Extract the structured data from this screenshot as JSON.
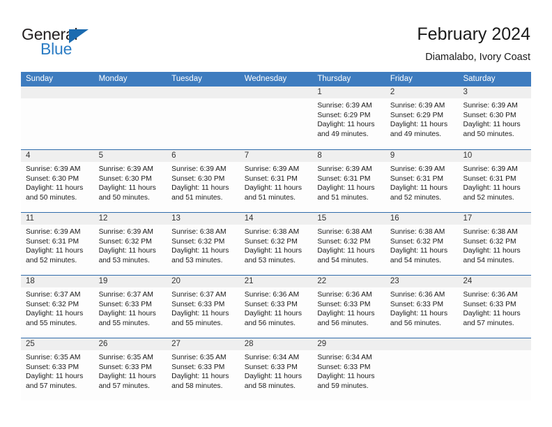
{
  "brand": {
    "name_top": "General",
    "name_bottom": "Blue",
    "accent_color": "#2b7cc4",
    "triangle_color": "#1b6bb0"
  },
  "header": {
    "title": "February 2024",
    "subtitle": "Diamalabo, Ivory Coast"
  },
  "calendar": {
    "header_bg": "#3e7cbf",
    "row_divider_color": "#2f6cab",
    "daynum_band_color": "#efefef",
    "weekdays": [
      "Sunday",
      "Monday",
      "Tuesday",
      "Wednesday",
      "Thursday",
      "Friday",
      "Saturday"
    ],
    "weeks": [
      [
        {
          "day": "",
          "lines": []
        },
        {
          "day": "",
          "lines": []
        },
        {
          "day": "",
          "lines": []
        },
        {
          "day": "",
          "lines": []
        },
        {
          "day": "1",
          "lines": [
            "Sunrise: 6:39 AM",
            "Sunset: 6:29 PM",
            "Daylight: 11 hours",
            "and 49 minutes."
          ]
        },
        {
          "day": "2",
          "lines": [
            "Sunrise: 6:39 AM",
            "Sunset: 6:29 PM",
            "Daylight: 11 hours",
            "and 49 minutes."
          ]
        },
        {
          "day": "3",
          "lines": [
            "Sunrise: 6:39 AM",
            "Sunset: 6:30 PM",
            "Daylight: 11 hours",
            "and 50 minutes."
          ]
        }
      ],
      [
        {
          "day": "4",
          "lines": [
            "Sunrise: 6:39 AM",
            "Sunset: 6:30 PM",
            "Daylight: 11 hours",
            "and 50 minutes."
          ]
        },
        {
          "day": "5",
          "lines": [
            "Sunrise: 6:39 AM",
            "Sunset: 6:30 PM",
            "Daylight: 11 hours",
            "and 50 minutes."
          ]
        },
        {
          "day": "6",
          "lines": [
            "Sunrise: 6:39 AM",
            "Sunset: 6:30 PM",
            "Daylight: 11 hours",
            "and 51 minutes."
          ]
        },
        {
          "day": "7",
          "lines": [
            "Sunrise: 6:39 AM",
            "Sunset: 6:31 PM",
            "Daylight: 11 hours",
            "and 51 minutes."
          ]
        },
        {
          "day": "8",
          "lines": [
            "Sunrise: 6:39 AM",
            "Sunset: 6:31 PM",
            "Daylight: 11 hours",
            "and 51 minutes."
          ]
        },
        {
          "day": "9",
          "lines": [
            "Sunrise: 6:39 AM",
            "Sunset: 6:31 PM",
            "Daylight: 11 hours",
            "and 52 minutes."
          ]
        },
        {
          "day": "10",
          "lines": [
            "Sunrise: 6:39 AM",
            "Sunset: 6:31 PM",
            "Daylight: 11 hours",
            "and 52 minutes."
          ]
        }
      ],
      [
        {
          "day": "11",
          "lines": [
            "Sunrise: 6:39 AM",
            "Sunset: 6:31 PM",
            "Daylight: 11 hours",
            "and 52 minutes."
          ]
        },
        {
          "day": "12",
          "lines": [
            "Sunrise: 6:39 AM",
            "Sunset: 6:32 PM",
            "Daylight: 11 hours",
            "and 53 minutes."
          ]
        },
        {
          "day": "13",
          "lines": [
            "Sunrise: 6:38 AM",
            "Sunset: 6:32 PM",
            "Daylight: 11 hours",
            "and 53 minutes."
          ]
        },
        {
          "day": "14",
          "lines": [
            "Sunrise: 6:38 AM",
            "Sunset: 6:32 PM",
            "Daylight: 11 hours",
            "and 53 minutes."
          ]
        },
        {
          "day": "15",
          "lines": [
            "Sunrise: 6:38 AM",
            "Sunset: 6:32 PM",
            "Daylight: 11 hours",
            "and 54 minutes."
          ]
        },
        {
          "day": "16",
          "lines": [
            "Sunrise: 6:38 AM",
            "Sunset: 6:32 PM",
            "Daylight: 11 hours",
            "and 54 minutes."
          ]
        },
        {
          "day": "17",
          "lines": [
            "Sunrise: 6:38 AM",
            "Sunset: 6:32 PM",
            "Daylight: 11 hours",
            "and 54 minutes."
          ]
        }
      ],
      [
        {
          "day": "18",
          "lines": [
            "Sunrise: 6:37 AM",
            "Sunset: 6:32 PM",
            "Daylight: 11 hours",
            "and 55 minutes."
          ]
        },
        {
          "day": "19",
          "lines": [
            "Sunrise: 6:37 AM",
            "Sunset: 6:33 PM",
            "Daylight: 11 hours",
            "and 55 minutes."
          ]
        },
        {
          "day": "20",
          "lines": [
            "Sunrise: 6:37 AM",
            "Sunset: 6:33 PM",
            "Daylight: 11 hours",
            "and 55 minutes."
          ]
        },
        {
          "day": "21",
          "lines": [
            "Sunrise: 6:36 AM",
            "Sunset: 6:33 PM",
            "Daylight: 11 hours",
            "and 56 minutes."
          ]
        },
        {
          "day": "22",
          "lines": [
            "Sunrise: 6:36 AM",
            "Sunset: 6:33 PM",
            "Daylight: 11 hours",
            "and 56 minutes."
          ]
        },
        {
          "day": "23",
          "lines": [
            "Sunrise: 6:36 AM",
            "Sunset: 6:33 PM",
            "Daylight: 11 hours",
            "and 56 minutes."
          ]
        },
        {
          "day": "24",
          "lines": [
            "Sunrise: 6:36 AM",
            "Sunset: 6:33 PM",
            "Daylight: 11 hours",
            "and 57 minutes."
          ]
        }
      ],
      [
        {
          "day": "25",
          "lines": [
            "Sunrise: 6:35 AM",
            "Sunset: 6:33 PM",
            "Daylight: 11 hours",
            "and 57 minutes."
          ]
        },
        {
          "day": "26",
          "lines": [
            "Sunrise: 6:35 AM",
            "Sunset: 6:33 PM",
            "Daylight: 11 hours",
            "and 57 minutes."
          ]
        },
        {
          "day": "27",
          "lines": [
            "Sunrise: 6:35 AM",
            "Sunset: 6:33 PM",
            "Daylight: 11 hours",
            "and 58 minutes."
          ]
        },
        {
          "day": "28",
          "lines": [
            "Sunrise: 6:34 AM",
            "Sunset: 6:33 PM",
            "Daylight: 11 hours",
            "and 58 minutes."
          ]
        },
        {
          "day": "29",
          "lines": [
            "Sunrise: 6:34 AM",
            "Sunset: 6:33 PM",
            "Daylight: 11 hours",
            "and 59 minutes."
          ]
        },
        {
          "day": "",
          "lines": []
        },
        {
          "day": "",
          "lines": []
        }
      ]
    ]
  }
}
